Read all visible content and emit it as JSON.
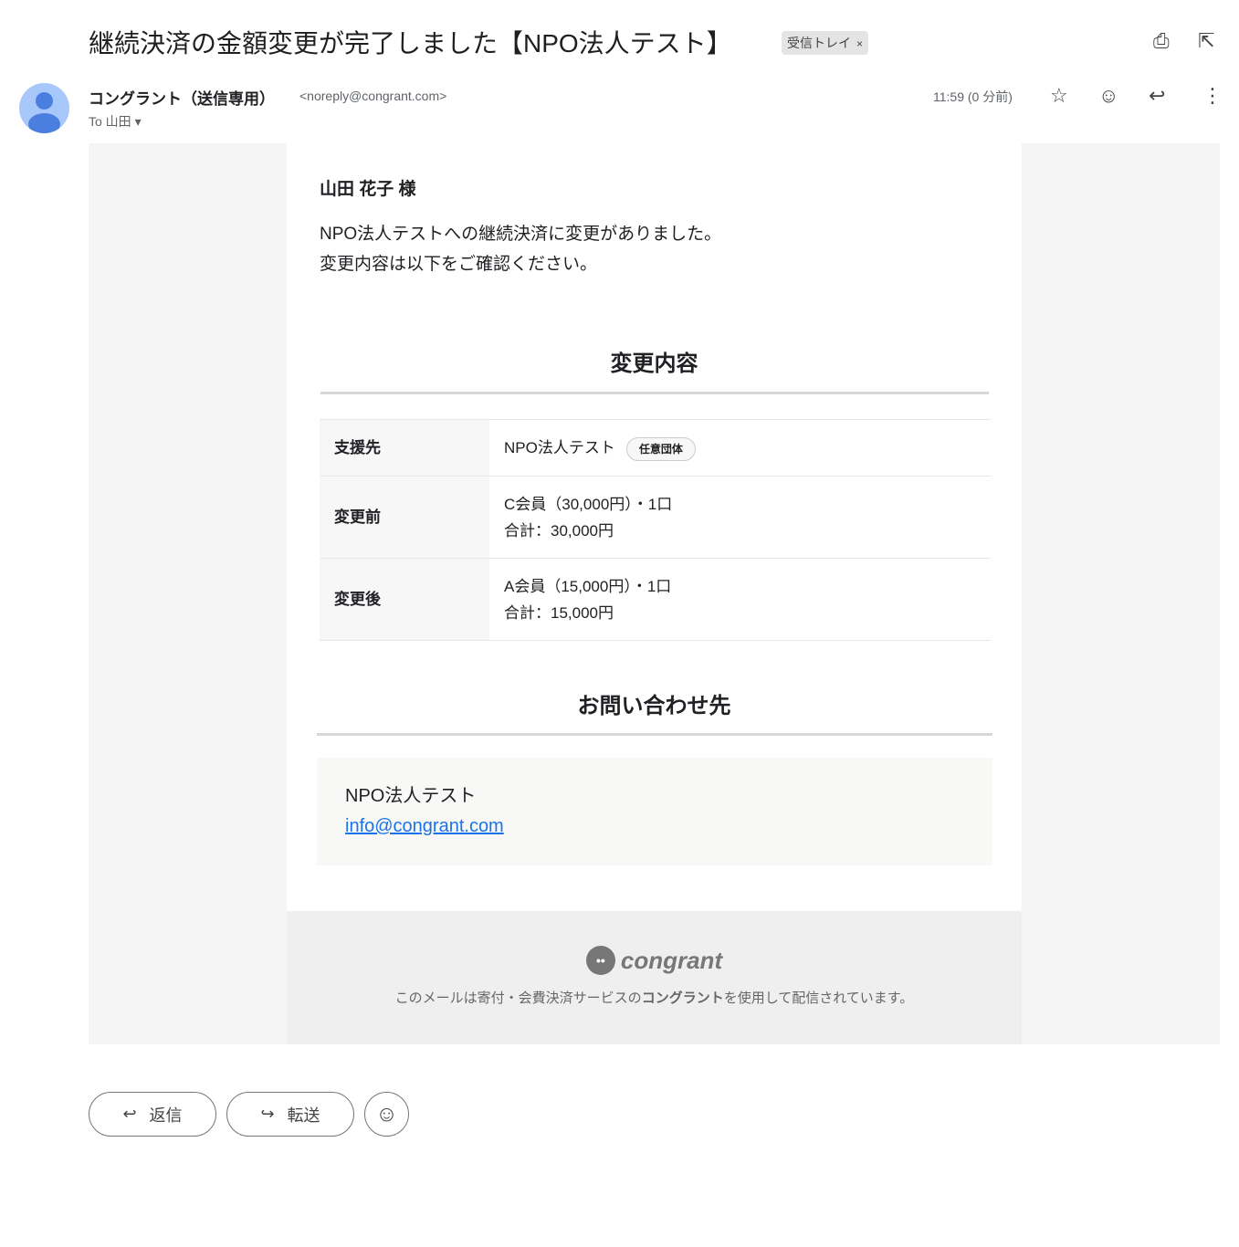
{
  "header": {
    "subject": "継続決済の金額変更が完了しました【NPO法人テスト】",
    "label": "受信トレイ",
    "label_close": "×"
  },
  "sender": {
    "name": "コングラント（送信専用）",
    "email": "<noreply@congrant.com>",
    "to": "To 山田",
    "time": "11:59 (0 分前)"
  },
  "body": {
    "greeting": "山田 花子 様",
    "intro1": "NPO法人テストへの継続決済に変更がありました。",
    "intro2": "変更内容は以下をご確認ください。",
    "section1": "変更内容",
    "rows": [
      {
        "key": "支援先",
        "line1": "NPO法人テスト",
        "tag": "任意団体"
      },
      {
        "key": "変更前",
        "line1": "C会員（30,000円）・1口",
        "line2": "合計：30,000円"
      },
      {
        "key": "変更後",
        "line1": "A会員（15,000円）・1口",
        "line2": "合計：15,000円"
      }
    ],
    "section2": "お問い合わせ先",
    "contact_name": "NPO法人テスト",
    "contact_email": "info@congrant.com"
  },
  "footer": {
    "logo": "congrant",
    "text_pre": "このメールは寄付・会費決済サービスの",
    "text_bold": "コングラント",
    "text_post": "を使用して配信されています。"
  },
  "actions": {
    "reply": "返信",
    "forward": "転送"
  }
}
